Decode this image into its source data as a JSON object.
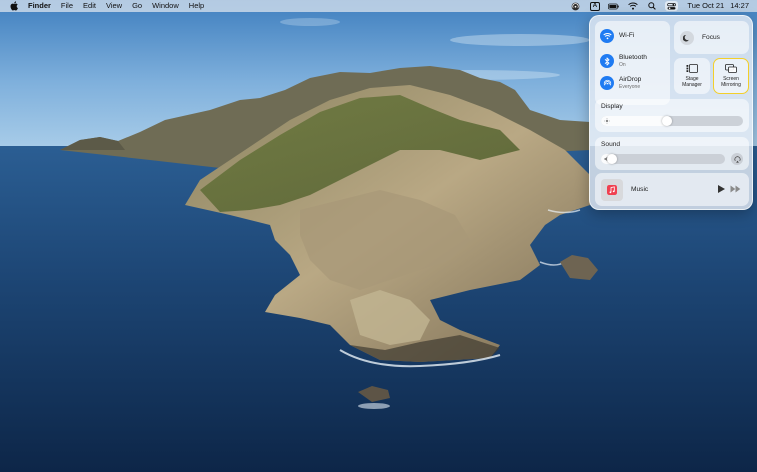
{
  "menubar": {
    "app_name": "Finder",
    "menus": [
      "File",
      "Edit",
      "View",
      "Go",
      "Window",
      "Help"
    ],
    "status_icons": [
      "airdrop-status-icon",
      "input-source-icon",
      "battery-icon",
      "wifi-icon",
      "spotlight-icon",
      "control-center-icon"
    ],
    "input_source_letter": "A",
    "clock": {
      "date": "Tue Oct 21",
      "time": "14:27"
    }
  },
  "control_center": {
    "network": {
      "wifi": {
        "title": "Wi-Fi",
        "subtitle": ""
      },
      "bluetooth": {
        "title": "Bluetooth",
        "subtitle": "On"
      },
      "airdrop": {
        "title": "AirDrop",
        "subtitle": "Everyone"
      }
    },
    "focus": {
      "label": "Focus"
    },
    "stage_manager": {
      "label_line1": "Stage",
      "label_line2": "Manager"
    },
    "screen_mirroring": {
      "label_line1": "Screen",
      "label_line2": "Mirroring",
      "highlighted": true,
      "highlight_color": "#f3cf2a"
    },
    "display": {
      "title": "Display",
      "level": 0.5
    },
    "sound": {
      "title": "Sound",
      "level": 0.13
    },
    "music": {
      "label": "Music"
    }
  },
  "colors": {
    "accent_blue": "#1f7bf2",
    "panel_bg": "#e8eef5",
    "music_icon_red": "#f0404f"
  }
}
